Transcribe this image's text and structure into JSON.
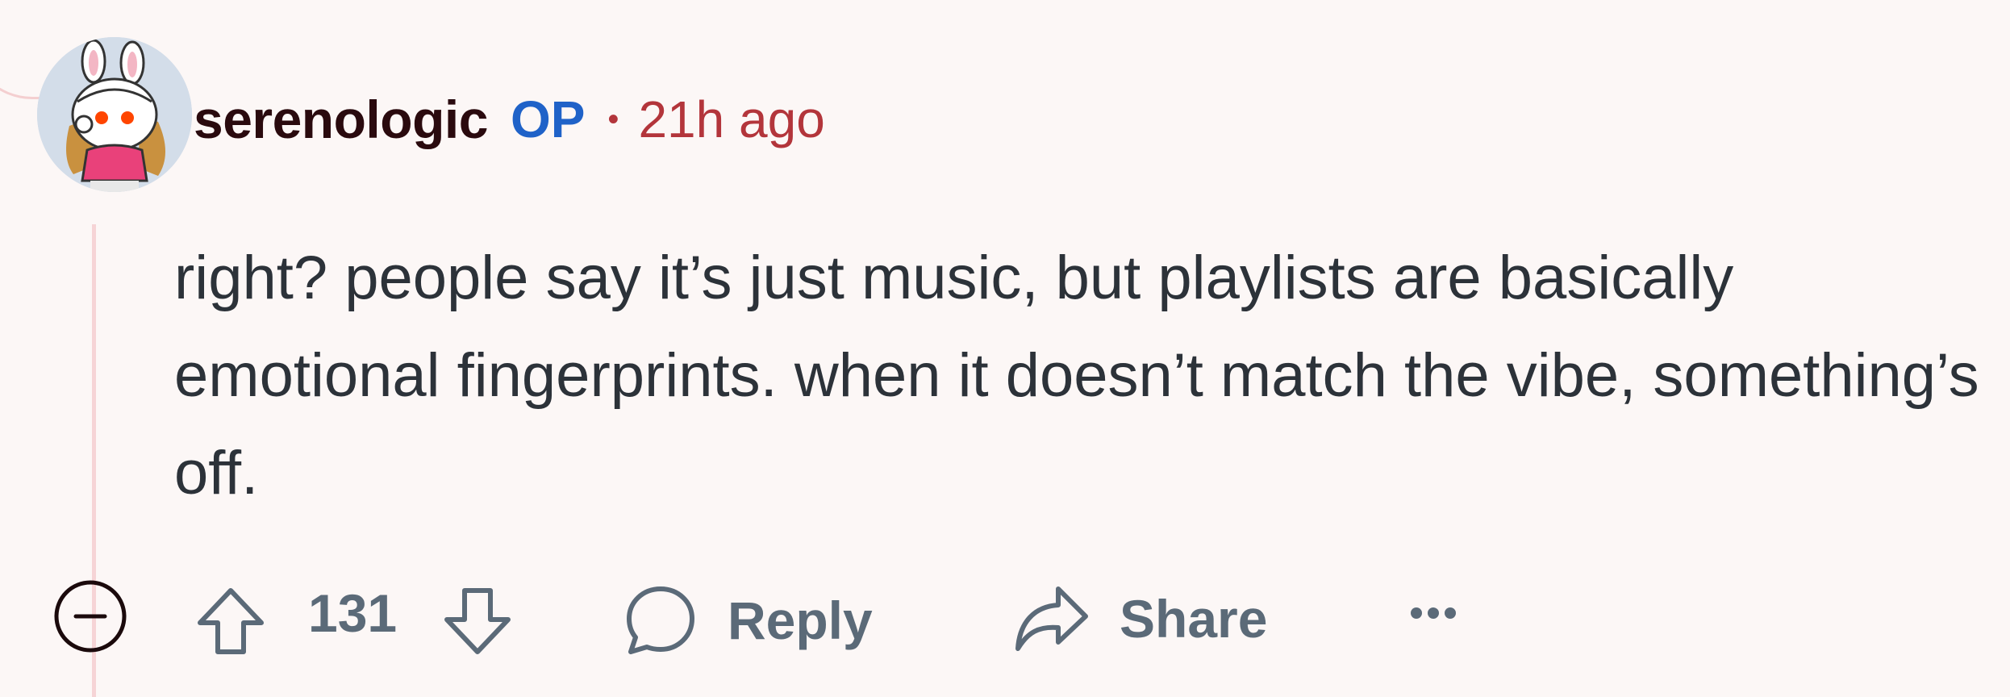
{
  "comment": {
    "author": "serenologic",
    "op_badge": "OP",
    "separator": "•",
    "timestamp": "21h ago",
    "body": "right? people say it’s just music, but playlists are basically emotional fingerprints. when it doesn’t match the vibe, something’s off.",
    "avatar_icon": "bunny-avatar-icon"
  },
  "actions": {
    "score": "131",
    "reply_label": "Reply",
    "share_label": "Share",
    "more_label": "•••"
  },
  "colors": {
    "background": "#fcf7f6",
    "username": "#2a0a0e",
    "op_badge": "#1f62c8",
    "timestamp": "#b3353b",
    "body_text": "#2c3239",
    "action_gray": "#5b6a78",
    "thread_line": "#f6d4d6"
  }
}
